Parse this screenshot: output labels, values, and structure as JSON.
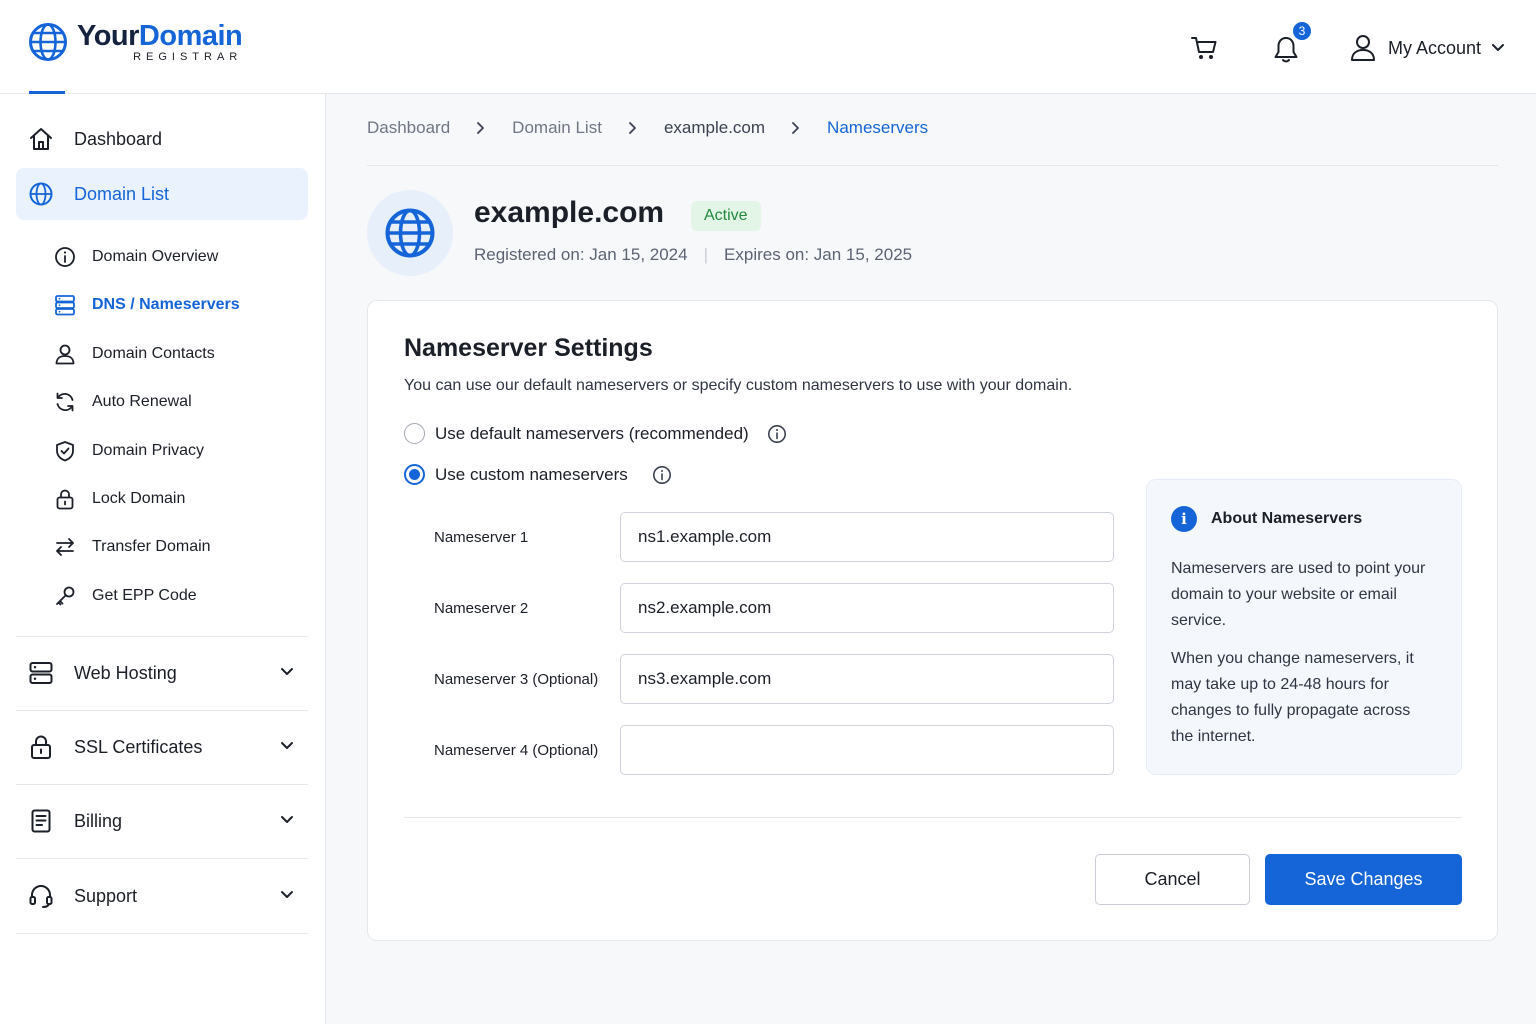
{
  "brand": {
    "name_part1": "Your",
    "name_part2": "Domain",
    "subtitle": "REGISTRAR",
    "accent_color": "#1565d8"
  },
  "header": {
    "cart_icon": "cart-icon",
    "notifications": {
      "icon": "bell-icon",
      "count": "3"
    },
    "account": {
      "label": "My Account",
      "icon": "user-icon"
    }
  },
  "sidebar": {
    "items": [
      {
        "label": "Dashboard",
        "icon": "home-icon"
      },
      {
        "label": "Domain List",
        "icon": "globe-icon",
        "active": true
      },
      {
        "label": "Web Hosting",
        "icon": "server-icon",
        "expandable": true
      },
      {
        "label": "SSL Certificates",
        "icon": "lock-icon",
        "expandable": true
      },
      {
        "label": "Billing",
        "icon": "document-icon",
        "expandable": true
      },
      {
        "label": "Support",
        "icon": "headset-icon",
        "expandable": true
      }
    ],
    "subitems": [
      {
        "label": "Domain Overview",
        "icon": "info-icon"
      },
      {
        "label": "DNS / Nameservers",
        "icon": "server-icon",
        "active": true
      },
      {
        "label": "Domain Contacts",
        "icon": "user-icon"
      },
      {
        "label": "Auto Renewal",
        "icon": "refresh-icon"
      },
      {
        "label": "Domain Privacy",
        "icon": "shield-icon"
      },
      {
        "label": "Lock Domain",
        "icon": "lock-icon"
      },
      {
        "label": "Transfer Domain",
        "icon": "transfer-icon"
      },
      {
        "label": "Get EPP Code",
        "icon": "key-icon"
      }
    ]
  },
  "breadcrumb": [
    "Dashboard",
    "Domain List",
    "example.com",
    "Nameservers"
  ],
  "domain": {
    "name": "example.com",
    "status": "Active",
    "registered": "Registered on: Jan 15, 2024",
    "expires": "Expires on: Jan 15, 2025",
    "separator": "|"
  },
  "settings": {
    "title": "Nameserver Settings",
    "description": "You can use our default nameservers or specify custom nameservers to use with your domain.",
    "options": [
      {
        "label": "Use default nameservers (recommended)",
        "checked": false
      },
      {
        "label": "Use custom nameservers",
        "checked": true
      }
    ],
    "nameservers": [
      {
        "label": "Nameserver 1",
        "value": "ns1.example.com"
      },
      {
        "label": "Nameserver 2",
        "value": "ns2.example.com"
      },
      {
        "label": "Nameserver 3 (Optional)",
        "value": "ns3.example.com"
      },
      {
        "label": "Nameserver 4 (Optional)",
        "value": ""
      }
    ],
    "about": {
      "icon_glyph": "i",
      "title": "About Nameservers",
      "paragraph1": "Nameservers are used to point your domain to your website or email service.",
      "paragraph2": "When you change nameservers, it may take up to 24-48 hours for changes to fully propagate across the internet."
    },
    "buttons": {
      "cancel": "Cancel",
      "save": "Save Changes"
    }
  }
}
